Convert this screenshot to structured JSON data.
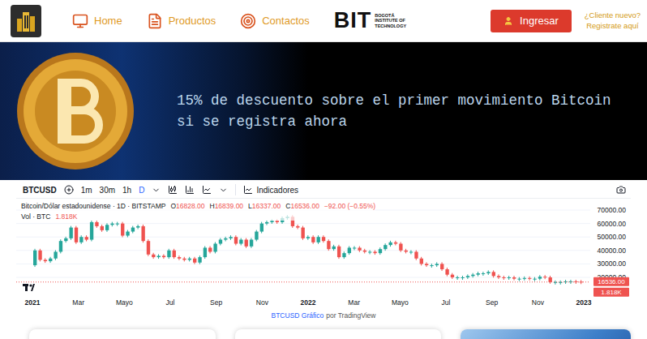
{
  "header": {
    "nav": [
      {
        "label": "Home",
        "selected": false
      },
      {
        "label": "Productos",
        "selected": false
      },
      {
        "label": "Contactos",
        "selected": false
      }
    ],
    "brand": {
      "name": "BIT",
      "subtitle": [
        "BOGOTÁ",
        "INSTITUTE OF",
        "TECHNOLOGY"
      ]
    },
    "login_button": "Ingresar",
    "register_link": [
      "¿Cliente nuevo?",
      "Registrate aquí"
    ]
  },
  "banner": {
    "lines": [
      "15% de descuento sobre el primer movimiento Bitcoin",
      "si se registra ahora"
    ]
  },
  "chart": {
    "toolbar": {
      "symbol": "BTCUSD",
      "intervals": [
        {
          "label": "1m",
          "selected": false
        },
        {
          "label": "30m",
          "selected": false
        },
        {
          "label": "1h",
          "selected": false
        },
        {
          "label": "D",
          "selected": true
        }
      ],
      "indicators": "Indicadores"
    },
    "legend": {
      "title": "Bitcoin/Dólar estadounidense · 1D · BITSTAMP",
      "ohlc": [
        {
          "label": "O",
          "value": "16828.00"
        },
        {
          "label": "H",
          "value": "16839.00"
        },
        {
          "label": "L",
          "value": "16337.00"
        },
        {
          "label": "C",
          "value": "16536.00"
        }
      ],
      "change": "−92.00 (−0.55%)",
      "volume_label": "Vol · BTC",
      "volume_value": "1.818K"
    },
    "y_ticks": [
      {
        "label": "70000.00",
        "value": 70000
      },
      {
        "label": "60000.00",
        "value": 60000
      },
      {
        "label": "50000.00",
        "value": 50000
      },
      {
        "label": "40000.00",
        "value": 40000
      },
      {
        "label": "30000.00",
        "value": 30000
      },
      {
        "label": "20000.00",
        "value": 20000
      }
    ],
    "x_ticks": [
      {
        "label": "2021",
        "month": 0
      },
      {
        "label": "Mar",
        "month": 2
      },
      {
        "label": "Mayo",
        "month": 4
      },
      {
        "label": "Jul",
        "month": 6
      },
      {
        "label": "Sep",
        "month": 8
      },
      {
        "label": "Nov",
        "month": 10
      },
      {
        "label": "2022",
        "month": 12
      },
      {
        "label": "Mar",
        "month": 14
      },
      {
        "label": "Mayo",
        "month": 16
      },
      {
        "label": "Jul",
        "month": 18
      },
      {
        "label": "Sep",
        "month": 20
      },
      {
        "label": "Nov",
        "month": 22
      },
      {
        "label": "2023",
        "month": 24
      }
    ],
    "last_price": {
      "label": "16536.00",
      "value": 16536
    },
    "last_volume": "1.818K",
    "series": {
      "open": 29000,
      "close": [
        40000,
        33000,
        32000,
        34000,
        39000,
        47000,
        49000,
        57000,
        46000,
        50000,
        48000,
        61000,
        58000,
        55000,
        59000,
        60000,
        60000,
        51000,
        54000,
        57000,
        58000,
        47000,
        37000,
        35000,
        36000,
        35000,
        40000,
        35000,
        34000,
        33000,
        34000,
        31000,
        35000,
        42000,
        39000,
        45000,
        48000,
        49000,
        50000,
        45000,
        48000,
        43000,
        48000,
        54000,
        60000,
        61000,
        62000,
        61000,
        64000,
        65000,
        58000,
        57000,
        49000,
        50000,
        46000,
        50000,
        47000,
        41000,
        43000,
        35000,
        38000,
        42000,
        42000,
        40000,
        39000,
        39000,
        38000,
        41000,
        44000,
        46000,
        45000,
        40000,
        39000,
        39000,
        34000,
        30000,
        29000,
        29000,
        30000,
        26000,
        22000,
        20000,
        20000,
        20000,
        21000,
        22000,
        23000,
        23000,
        24000,
        21000,
        20000,
        19800,
        20000,
        19000,
        19000,
        19500,
        19000,
        19000,
        20500,
        20000,
        16500,
        16500,
        16500,
        17000,
        17000,
        16800,
        16536
      ]
    },
    "caption": {
      "link": "BTCUSD Gráfico",
      "rest": "por TradingView"
    }
  },
  "cards": [
    {
      "kind": "plain"
    },
    {
      "kind": "plain"
    },
    {
      "kind": "image"
    }
  ]
}
